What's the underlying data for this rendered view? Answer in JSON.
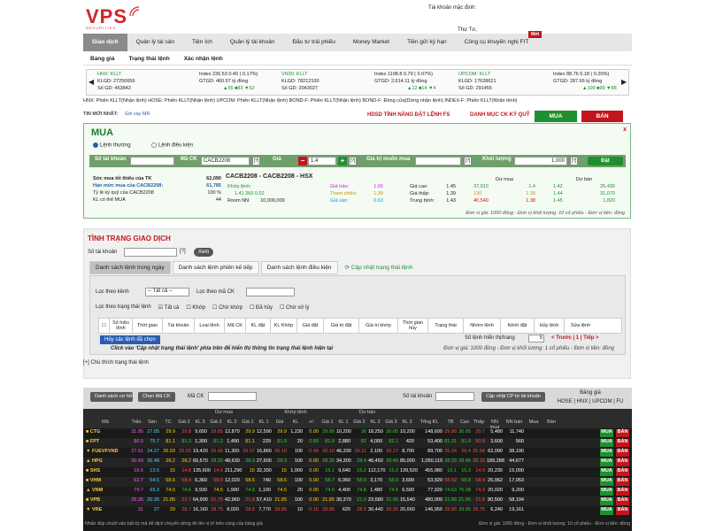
{
  "brand": {
    "name": "VPS",
    "tagline": "SECURITIES"
  },
  "account_label": "Tài khoản mặc định:",
  "user": "Thư Tư,",
  "nav": [
    "Giao dịch",
    "Quản lý tài sản",
    "Tiện ích",
    "Quản lý tài khoản",
    "Đầu tư trái phiếu",
    "Money Market",
    "Tiền gửi kỳ hạn",
    "Công cụ khuyến nghị FIT"
  ],
  "nav_badge": "Mới",
  "subnav": [
    "Bảng giá",
    "Trạng thái lệnh",
    "Xác nhận lệnh"
  ],
  "ticker": [
    {
      "name": "HNX: KLLT",
      "index": "Index 236.53 0.40 ( 0.17%)",
      "kl": "KLGD: 27250656",
      "gt": "GTGD: 460.97 tỷ đồng",
      "sogd": "Số GD: 463842",
      "ud": "▲55 ■83 ▼62"
    },
    {
      "name": "VN30: KLLT",
      "index": "Index 1198.8 0.79 ( 0.07%)",
      "kl": "KLGD: 78212100",
      "gt": "GTGD: 2,614.11 tỷ đồng",
      "sogd": "Số GD: 2043027",
      "ud": "▲12 ■14 ▼4"
    },
    {
      "name": "UPCOM: KLLT",
      "index": "Index 88.76 0.18 ( 0.20%)",
      "kl": "KLGD: 17628621",
      "gt": "GTGD: 287.66 tỷ đồng",
      "sogd": "Số GD: 291455",
      "ud": "▲109 ■99 ▼88"
    }
  ],
  "exchanges": "HNX: Phiên KLLT(Nhận lệnh)   HOSE: Phiên KLLT(Nhận lệnh)   UPCOM: Phiên KLLT(Nhận lệnh)   BOND-F: Phiên KLLT(Nhận lệnh)   BOND-F: Đóng cửa(Dừng nhận lệnh)   INDEX-F: Phiên KLLT(Nhận lệnh)",
  "news": {
    "label": "TIN MỚI NHẤT:",
    "text": "Gói vay MR"
  },
  "links": {
    "hdsd": "HDSD TÍNH NĂNG ĐẶT LỆNH FS",
    "dm": "DANH MỤC CK KÝ QUỸ"
  },
  "tabs": {
    "buy": "MUA",
    "sell": "BÁN"
  },
  "order": {
    "title": "MUA",
    "close": "x",
    "radio1": "Lệnh thường",
    "radio2": "Lệnh điều kiện",
    "acc_label": "Số tài khoản",
    "mack_label": "Mã CK",
    "mack": "CACB2208",
    "gia_label": "Giá",
    "gia": "1.4",
    "gtmm_label": "Giá trị muốn mua",
    "kl_label": "Khối lượng",
    "kl": "1,000",
    "submit": "Đặt",
    "q": "[?]",
    "left": [
      [
        "Sức mua tối thiểu của TK",
        "62,090"
      ],
      [
        "Hạn mức mua của CACB2208:",
        "61,785"
      ],
      [
        "Tỷ lệ ký quỹ của CACB2208",
        "100 %"
      ],
      [
        "KL có thể MUA",
        "44"
      ]
    ],
    "stock_title": "CACB2208 - CACB2208 - HSX",
    "kl_label2": "Khớp lệnh:",
    "kl_vals": "1.41      260      0.02",
    "room_label": "Room NN:",
    "room": "10,000,000",
    "tran_label": "Giá trần:",
    "tran": "1.65",
    "tc_label": "Tham chiếu:",
    "tc": "1.39",
    "san_label": "Giá sàn:",
    "san": "0.63",
    "cao_label": "Giá cao:",
    "cao": "1.45",
    "thap_label": "Giá thấp:",
    "thap": "1.39",
    "tb_label": "Trung bình:",
    "tb": "1.43",
    "dumua": "Dư mua",
    "duban": "Dư bán",
    "dm_rows": [
      [
        "37,910",
        "1.4"
      ],
      [
        "130",
        "1.39"
      ],
      [
        "40,540",
        "1.38"
      ]
    ],
    "db_rows": [
      [
        "1.42",
        "25,430"
      ],
      [
        "1.44",
        "31,070"
      ],
      [
        "1.45",
        "1,820"
      ]
    ],
    "unit": "Đơn vị giá: 1000 đồng - Đơn vị khối lượng: 10 cổ phiếu - Đơn vị tiền: đồng"
  },
  "status": {
    "title": "TÌNH TRẠNG GIAO DỊCH",
    "acc_label": "Số tài khoản",
    "view": "Xem",
    "q": "[?]",
    "tabs": [
      "Danh sách lệnh trong ngày",
      "Danh sách lệnh phiên kế tiếp",
      "Danh sách lệnh điều kiện"
    ],
    "refresh": "Cập nhật trạng thái lệnh",
    "kenh_label": "Lọc theo kênh",
    "kenh": "-- Tất cả --",
    "mack_label": "Lọc theo mã CK",
    "tt_label": "Lọc theo trạng thái lệnh",
    "tt": [
      "Tất cả",
      "Khớp",
      "Chờ khớp",
      "Đã hủy",
      "Chờ xử lý"
    ],
    "cols": [
      "Số hiệu lệnh",
      "Thời gian",
      "Tài khoản",
      "Loại lệnh",
      "Mã CK",
      "KL đặt",
      "KL Khớp",
      "Giá đặt",
      "Giá trị đặt",
      "Giá trị khớp",
      "Thời gian hủy",
      "Trạng thái",
      "Nhóm lệnh",
      "Kênh đặt",
      "Hủy lệnh",
      "Sửa lệnh"
    ],
    "cancel_btn": "Hủy các lệnh đã chọn",
    "perpage": "Số lệnh hiển thị/trang",
    "perpage_val": "5",
    "pager": "< Trước | 1 | Tiếp >",
    "warn": "Click vào 'Cập nhật trạng thái lệnh' phía trên để hiển thị thông tin trạng thái lệnh hiện tại",
    "unit": "Đơn vị giá: 1000 đồng - Đơn vị khối lượng: 1 cổ phiếu - Đơn vị tiền: đồng",
    "note": "[+] Chú thích trạng thái lệnh"
  },
  "board": {
    "btn1": "Danh sách cơ hữu xem danh mục",
    "btn2": "Chọn Mã CK",
    "mack": "Mã CK",
    "acc": "Số tài khoản",
    "update": "Cập nhật CP từ tài khoản",
    "bg": "Bảng giá",
    "bg_links": "HOSE | HNX | UPCOM | FU",
    "cols": [
      "Mã",
      "Trần",
      "Sàn",
      "TC",
      "Giá 3",
      "KL 3",
      "Giá 2",
      "KL 2",
      "Giá 1",
      "KL 1",
      "Giá",
      "KL",
      "+/-",
      "Giá 1",
      "KL 1",
      "Giá 2",
      "KL 2",
      "Giá 3",
      "KL 3",
      "Tổng KL",
      "TB",
      "Cao",
      "Thấp",
      "NN mua",
      "NN bán",
      "Mua",
      "Bán"
    ],
    "groups": {
      "dumua": "Dư mua",
      "khop": "Khớp lệnh",
      "duban": "Dư bán",
      "gia": "Giá"
    },
    "rows": [
      [
        "■ CTG",
        "31.95",
        "27.85",
        "29.9",
        "29.8",
        "9,650",
        "29.85",
        "12,870",
        "29.9",
        "12,590",
        "29.9",
        "1,230",
        "0.00",
        "29.95",
        "10,200",
        "30",
        "18,250",
        "30.05",
        "10,200",
        "148,600",
        "29.88",
        "30.05",
        "29.7",
        "5,480",
        "11,740"
      ],
      [
        "■ FPT",
        "86.5",
        "75.7",
        "81.1",
        "81.3",
        "1,300",
        "81.2",
        "1,490",
        "81.1",
        "229",
        "81.9",
        "20",
        "0.80",
        "81.9",
        "2,880",
        "82",
        "4,000",
        "82.1",
        "420",
        "53,400",
        "81.31",
        "81.9",
        "80.8",
        "3,600",
        "560"
      ],
      [
        "▼ FUEVFVND",
        "27.61",
        "24.27",
        "26.59",
        "20.55",
        "19,420",
        "26.06",
        "11,300",
        "26.07",
        "16,860",
        "26.10",
        "100",
        "-0.49",
        "26.10",
        "46,330",
        "26.11",
        "2,100",
        "26.17",
        "8,700",
        "89,700",
        "26.34",
        "26.4",
        "25.68",
        "62,090",
        "38,190"
      ],
      [
        "▲ HPG",
        "30.43",
        "26.48",
        "28.2",
        "28.2",
        "60,570",
        "28.25",
        "48,630",
        "28.3",
        "27,600",
        "28.3",
        "100",
        "0.00",
        "28.35",
        "34,300",
        "28.4",
        "46,450",
        "28.45",
        "85,000",
        "1,050,110",
        "28.33",
        "28.45",
        "28.15",
        "189,288",
        "44,677"
      ],
      [
        "■ SHS",
        "16.5",
        "13.5",
        "15",
        "14.8",
        "135,600",
        "14.9",
        "211,290",
        "15",
        "32,390",
        "15",
        "1,000",
        "0.00",
        "15.1",
        "9,640",
        "15.2",
        "112,170",
        "15.3",
        "139,520",
        "455,980",
        "15.1",
        "15.3",
        "14.9",
        "20,230",
        "15,000"
      ],
      [
        "■ VHM",
        "62.7",
        "54.5",
        "58.6",
        "58.4",
        "6,360",
        "58.5",
        "12,020",
        "58.6",
        "740",
        "58.6",
        "100",
        "0.00",
        "58.7",
        "6,060",
        "58.8",
        "3,170",
        "58.9",
        "3,690",
        "53,920",
        "58.52",
        "58.8",
        "58.4",
        "26,062",
        "17,053"
      ],
      [
        "▲ VNM",
        "79.7",
        "69.3",
        "74.5",
        "74.6",
        "9,930",
        "74.5",
        "1,990",
        "74.8",
        "1,190",
        "74.5",
        "20",
        "0.00",
        "74.9",
        "4,400",
        "74.8",
        "1,480",
        "74.9",
        "6,590",
        "77,920",
        "74.53",
        "75.08",
        "74.3",
        "20,020",
        "9,200"
      ],
      [
        "■ VPB",
        "25.35",
        "20.35",
        "21.85",
        "21.7",
        "64,900",
        "21.75",
        "42,960",
        "21.8",
        "57,410",
        "21.85",
        "100",
        "0.00",
        "21.85",
        "30,370",
        "21.9",
        "23,680",
        "21.95",
        "15,540",
        "480,000",
        "21.86",
        "21.95",
        "21.8",
        "80,500",
        "58,104"
      ],
      [
        "▼ VRE",
        "31",
        "27",
        "29",
        "28.7",
        "16,160",
        "28.75",
        "8,020",
        "28.8",
        "7,770",
        "28.85",
        "10",
        "-0.15",
        "28.85",
        "620",
        "28.9",
        "30,440",
        "28.95",
        "20,660",
        "146,950",
        "28.86",
        "29.05",
        "28.75",
        "6,240",
        "19,161"
      ]
    ],
    "buy": "MUA",
    "sell": "BÁN",
    "footer": "Nhấn đúp chuột vào bất kỳ mã để dịch chuyển dòng đó lên vị trí trên cùng của bảng giá",
    "footer_unit": "Đơn vị giá: 1000 đồng - Đơn vị khối lượng: 10 cổ phiếu - Đơn vị tiền: đồng"
  }
}
